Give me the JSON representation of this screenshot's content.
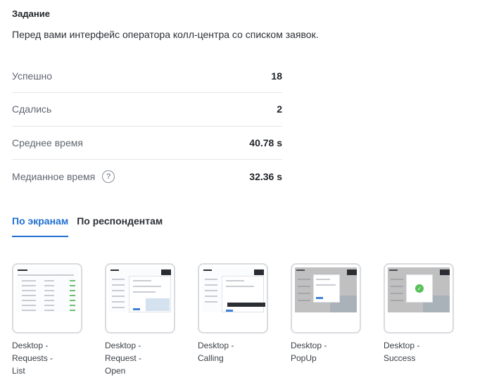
{
  "task": {
    "title": "Задание",
    "description": "Перед вами интерфейс оператора колл-центра со списком заявок."
  },
  "stats": [
    {
      "label": "Успешно",
      "value": "18"
    },
    {
      "label": "Сдались",
      "value": "2"
    },
    {
      "label": "Среднее время",
      "value": "40.78 s"
    },
    {
      "label": "Медианное время",
      "value": "32.36 s",
      "help_icon": "question-circle-icon"
    }
  ],
  "tabs": [
    {
      "label": "По экранам",
      "active": true
    },
    {
      "label": "По респондентам",
      "active": false
    }
  ],
  "screens": [
    {
      "caption": "Desktop - Requests - List"
    },
    {
      "caption": "Desktop - Request - Open"
    },
    {
      "caption": "Desktop - Calling"
    },
    {
      "caption": "Desktop - PopUp"
    },
    {
      "caption": "Desktop - Success"
    }
  ],
  "colors": {
    "accent": "#1f6fd1",
    "divider": "#e3e5e8",
    "success": "#58c05a"
  }
}
